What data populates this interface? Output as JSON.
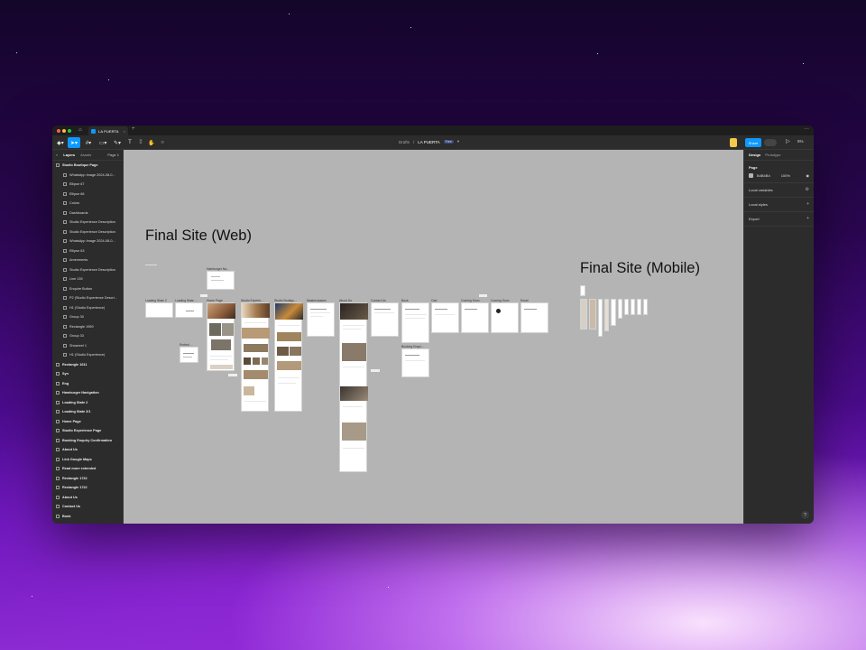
{
  "window": {
    "tab_title": "LA PUERTA",
    "tab_close": "×",
    "tab_add": "+",
    "more": "···"
  },
  "toolbar": {
    "breadcrumb_folder": "Drafts",
    "breadcrumb_sep": "/",
    "file_name": "LA PUERTA",
    "plan_badge": "Free",
    "share_label": "Share",
    "play_icon": "▷",
    "zoom_label": "5%"
  },
  "left_panel": {
    "tabs": [
      "Layers",
      "Assets"
    ],
    "page_label": "Page 1",
    "layers": [
      {
        "name": "Studio Boutique Page",
        "level": "top"
      },
      {
        "name": "WhatsApp Image 2024-08-0...",
        "level": "child"
      },
      {
        "name": "Ellipse 67",
        "level": "child"
      },
      {
        "name": "Ellipse 66",
        "level": "child"
      },
      {
        "name": "Colors",
        "level": "child"
      },
      {
        "name": "Dashboards",
        "level": "child"
      },
      {
        "name": "Studio Experience Description",
        "level": "child"
      },
      {
        "name": "Studio Experience Description",
        "level": "child"
      },
      {
        "name": "WhatsApp Image 2024-08-0...",
        "level": "child"
      },
      {
        "name": "Ellipse 63",
        "level": "child"
      },
      {
        "name": "Amenments",
        "level": "child"
      },
      {
        "name": "Studio Experience Description",
        "level": "child"
      },
      {
        "name": "Line 139",
        "level": "child"
      },
      {
        "name": "Enquire Button",
        "level": "child"
      },
      {
        "name": "P2 (Studio Experience Descri...",
        "level": "child"
      },
      {
        "name": "H1 (Studio Experience)",
        "level": "child"
      },
      {
        "name": "Group 30",
        "level": "child"
      },
      {
        "name": "Rectangle 1959",
        "level": "child"
      },
      {
        "name": "Group 33",
        "level": "child"
      },
      {
        "name": "Showreel 1",
        "level": "child"
      },
      {
        "name": "H1 (Studio Experience)",
        "level": "child"
      },
      {
        "name": "Rectangle 1611",
        "level": "top"
      },
      {
        "name": "Syn",
        "level": "top"
      },
      {
        "name": "Eng",
        "level": "top"
      },
      {
        "name": "Hamburger Navigation",
        "level": "top"
      },
      {
        "name": "Loading State 2",
        "level": "top"
      },
      {
        "name": "Loading State 2/1",
        "level": "top"
      },
      {
        "name": "Home Page",
        "level": "top"
      },
      {
        "name": "Studio Experience Page",
        "level": "top"
      },
      {
        "name": "Booking Enquiry Confirmation",
        "level": "top"
      },
      {
        "name": "About Us",
        "level": "top"
      },
      {
        "name": "Link Google Maps",
        "level": "top"
      },
      {
        "name": "Read more extended",
        "level": "top"
      },
      {
        "name": "Rectangle 1722",
        "level": "top"
      },
      {
        "name": "Rectangle 1722",
        "level": "top"
      },
      {
        "name": "About Us",
        "level": "top"
      },
      {
        "name": "Contact Us",
        "level": "top"
      },
      {
        "name": "Book",
        "level": "top"
      }
    ]
  },
  "canvas": {
    "heading_web": "Final Site (Web)",
    "heading_mobile": "Final Site (Mobile)",
    "frames": [
      {
        "label": "Loading State 2"
      },
      {
        "label": "Loading State ..."
      },
      {
        "label": "Home Page"
      },
      {
        "label": "Studio Experie..."
      },
      {
        "label": "Studio Bootiqu..."
      },
      {
        "label": "Masterclasses"
      },
      {
        "label": "About Us"
      },
      {
        "label": "Contact Us"
      },
      {
        "label": "Book"
      },
      {
        "label": "Cart"
      },
      {
        "label": "Coming Soon"
      },
      {
        "label": "Coming Soon"
      },
      {
        "label": "Email"
      },
      {
        "label": "Hamburger Na..."
      },
      {
        "label": "Booking Enqui..."
      },
      {
        "label": "Embed ..."
      }
    ]
  },
  "right_panel": {
    "tabs": [
      "Design",
      "Prototype"
    ],
    "page_title": "Page",
    "bg_hex": "B4B4B4",
    "bg_opacity": "100%",
    "local_variables": "Local variables",
    "local_styles": "Local styles",
    "export": "Export",
    "help": "?"
  },
  "colors": {
    "accent": "#0d99ff",
    "canvas_bg": "#b4b4b4",
    "panel_bg": "#2c2c2c"
  }
}
